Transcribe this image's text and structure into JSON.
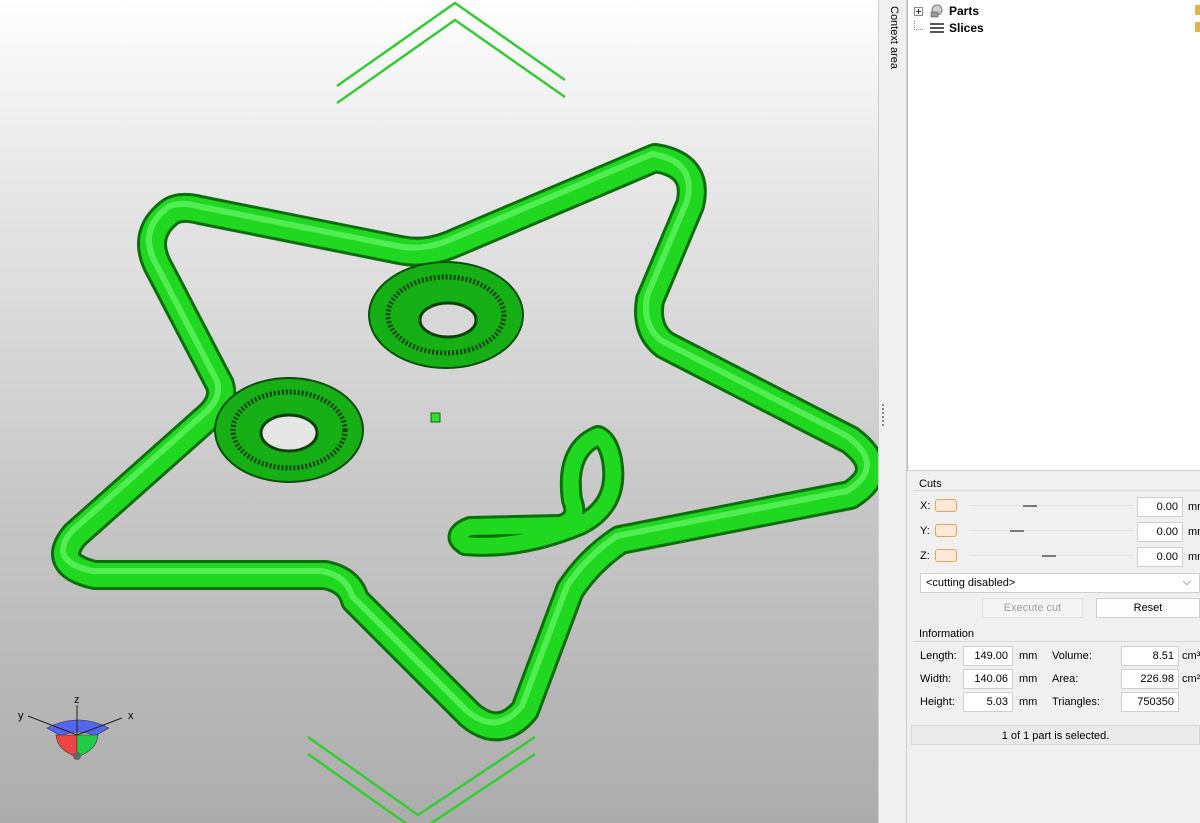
{
  "context_tab": {
    "label": "Context area"
  },
  "tree": {
    "items": [
      {
        "label": "Parts",
        "icon": "parts-icon"
      },
      {
        "label": "Slices",
        "icon": "slices-icon"
      }
    ]
  },
  "cuts": {
    "title": "Cuts",
    "axes": [
      {
        "label": "X:",
        "value": "0.00",
        "unit": "mm"
      },
      {
        "label": "Y:",
        "value": "0.00",
        "unit": "mm"
      },
      {
        "label": "Z:",
        "value": "0.00",
        "unit": "mm"
      }
    ],
    "mode": "<cutting disabled>",
    "execute_label": "Execute cut",
    "reset_label": "Reset"
  },
  "information": {
    "title": "Information",
    "length": {
      "label": "Length:",
      "value": "149.00",
      "unit": "mm"
    },
    "width": {
      "label": "Width:",
      "value": "140.06",
      "unit": "mm"
    },
    "height": {
      "label": "Height:",
      "value": "5.03",
      "unit": "mm"
    },
    "volume": {
      "label": "Volume:",
      "value": "8.51",
      "unit": "cm³"
    },
    "area": {
      "label": "Area:",
      "value": "226.98",
      "unit": "cm²"
    },
    "triangles": {
      "label": "Triangles:",
      "value": "750350"
    }
  },
  "status": "1 of 1 part is selected.",
  "axes_gizmo": {
    "x": "x",
    "y": "y",
    "z": "z"
  },
  "colors": {
    "model": "#22dd22",
    "accent": "#e8a35a",
    "guide": "#33cc33"
  }
}
